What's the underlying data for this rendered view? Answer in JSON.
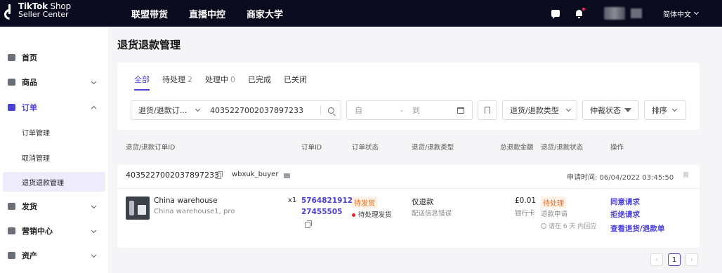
{
  "brand": {
    "line1_bold": "TikTok",
    "line1_rest": " Shop",
    "line2": "Seller Center"
  },
  "topnav": [
    "联盟带货",
    "直播中控",
    "商家大学"
  ],
  "topbar": {
    "language": "简体中文"
  },
  "sidebar": {
    "items": [
      {
        "label": "首页",
        "icon": "home-icon"
      },
      {
        "label": "商品",
        "icon": "product-icon"
      },
      {
        "label": "订单",
        "icon": "order-icon"
      },
      {
        "label": "发货",
        "icon": "truck-icon"
      },
      {
        "label": "营销中心",
        "icon": "megaphone-icon"
      },
      {
        "label": "资产",
        "icon": "wallet-icon"
      }
    ],
    "order_sub": [
      "订单管理",
      "取消管理",
      "退货退款管理"
    ]
  },
  "page": {
    "title": "退货退款管理"
  },
  "tabs": [
    {
      "label": "全部",
      "count": ""
    },
    {
      "label": "待处理",
      "count": "2"
    },
    {
      "label": "处理中",
      "count": "0"
    },
    {
      "label": "已完成",
      "count": ""
    },
    {
      "label": "已关闭",
      "count": ""
    }
  ],
  "filters": {
    "search_type": "退货/退款订...",
    "search_value": "4035227002037897233",
    "date_from_placeholder": "自",
    "date_dash": "-",
    "date_to_placeholder": "到",
    "type_select": "退货/退款类型",
    "arbitration": "仲裁状态",
    "sort": "排序"
  },
  "columns": [
    "退货/退款订单ID",
    "订单ID",
    "订单状态",
    "退货/退款类型",
    "总退款金额",
    "退货/退款状态",
    "操作"
  ],
  "order": {
    "return_id": "4035227002037897233",
    "buyer": "wbxuk_buyer",
    "apply_time_label": "申请时间: 06/04/2022 03:45:50",
    "product_name": "China warehouse",
    "product_sku": "China warehouse1, pro",
    "quantity": "x1",
    "order_id_line1": "5764821912",
    "order_id_line2": "27455505",
    "order_status_pill": "待发货",
    "order_status_sub": "待处理发货",
    "refund_type": "仅退款",
    "refund_reason": "配送信息错误",
    "amount": "£0.01",
    "payment": "银行卡",
    "refund_status_pill": "待处理",
    "refund_status_sub": "退款申请",
    "deadline": "请在 6 天 内回应",
    "actions": [
      "同意请求",
      "拒绝请求",
      "查看退货/退款单"
    ]
  },
  "pagination": {
    "prev": "‹",
    "current": "1",
    "next": "›"
  }
}
